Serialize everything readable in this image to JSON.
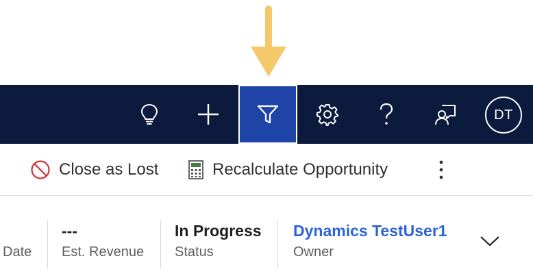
{
  "annotation": {
    "arrow_color": "#f5c96b"
  },
  "topbar": {
    "background": "#0b1a3d",
    "active_background": "#1f44a8",
    "buttons": [
      {
        "icon": "lightbulb-icon",
        "label": ""
      },
      {
        "icon": "plus-icon",
        "label": ""
      },
      {
        "icon": "filter-icon",
        "label": "",
        "active": true
      },
      {
        "icon": "gear-icon",
        "label": ""
      },
      {
        "icon": "question-icon",
        "label": ""
      },
      {
        "icon": "feedback-icon",
        "label": ""
      }
    ],
    "avatar_initials": "DT"
  },
  "commandbar": {
    "close_as_lost": "Close as Lost",
    "recalculate": "Recalculate Opportunity",
    "more_icon": "more-vertical-icon"
  },
  "header_fields": {
    "date_label": "Date",
    "revenue_value": "---",
    "revenue_label": "Est. Revenue",
    "status_value": "In Progress",
    "status_label": "Status",
    "owner_value": "Dynamics TestUser1",
    "owner_label": "Owner",
    "expand_icon": "chevron-down-icon"
  }
}
